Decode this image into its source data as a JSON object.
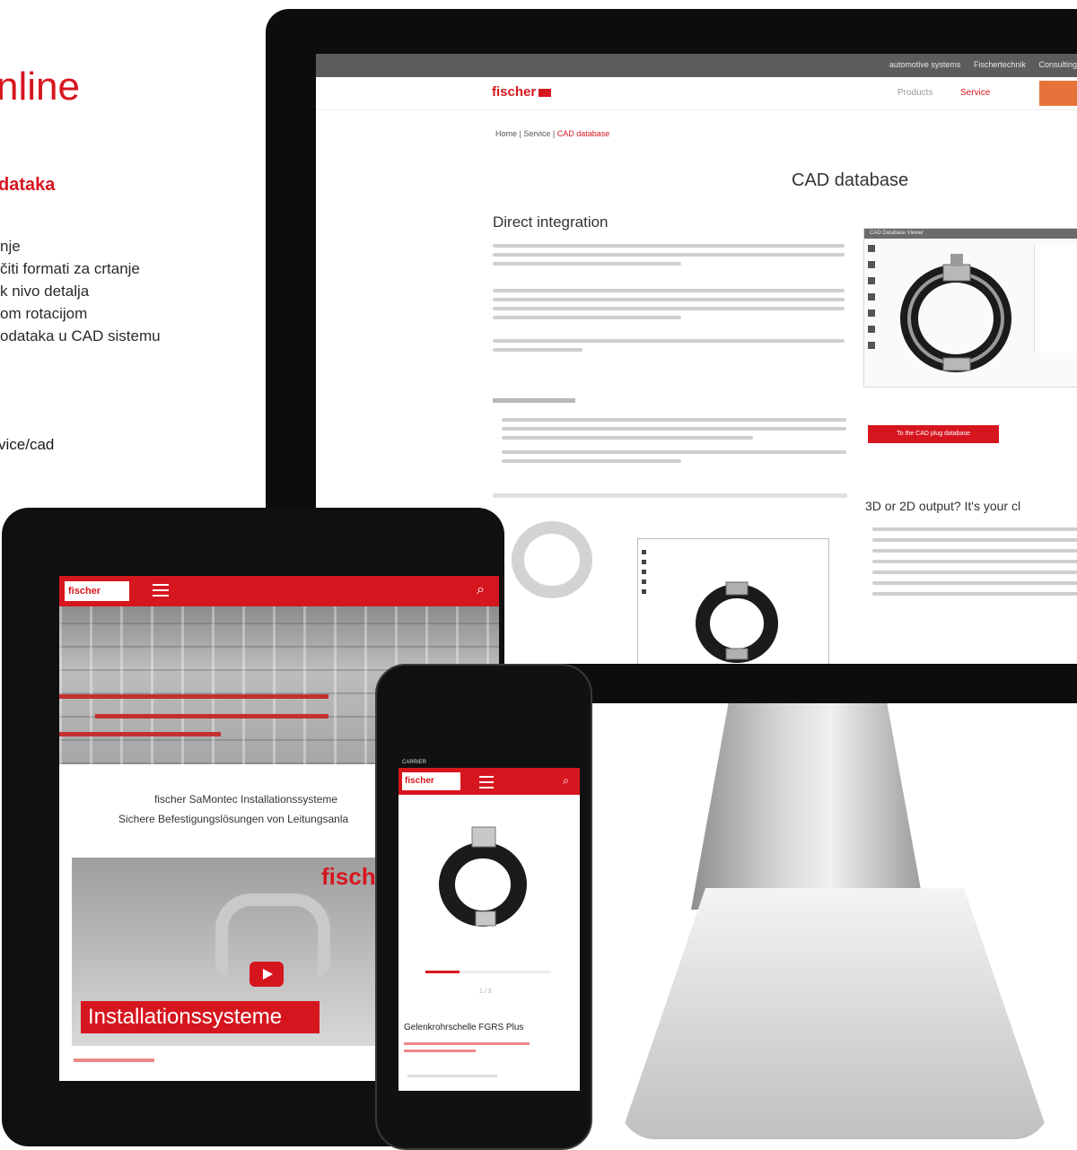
{
  "promo": {
    "title": "nline",
    "subtitle": "dataka",
    "features": [
      "nje",
      "čiti formati za crtanje",
      "k nivo detalja",
      "om rotacijom",
      "odataka u CAD sistemu"
    ],
    "url": "vice/cad"
  },
  "desktop": {
    "topbar_items": [
      "automotive systems",
      "Fischertechnik",
      "Consulting"
    ],
    "logo": "fischer",
    "nav": {
      "products": "Products",
      "service": "Service"
    },
    "breadcrumb": {
      "home": "Home",
      "service": "Service",
      "current": "CAD database"
    },
    "page_title": "CAD database",
    "section1_title": "Direct integration",
    "cta_button": "To the CAD plug database",
    "section2_title": "3D or 2D output? It's your cl",
    "viewer_title": "CAD Database Viewer"
  },
  "tablet": {
    "logo": "fischer",
    "headline1": "fischer SaMontec Installationssysteme",
    "headline2": "Sichere Befestigungslösungen von Leitungsanla",
    "video_brand": "fische",
    "banner": "Installationssysteme"
  },
  "phone": {
    "carrier": "CARRIER",
    "logo": "fischer",
    "product_name": "Gelenkrohrschelle FGRS Plus",
    "pager": "1 / 3"
  },
  "colors": {
    "brand_red": "#d6161f",
    "orange": "#e8733a"
  }
}
